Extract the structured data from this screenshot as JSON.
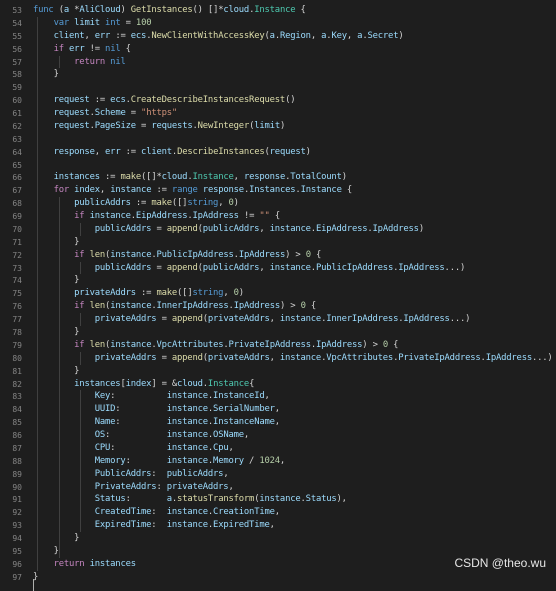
{
  "editor": {
    "lines": [
      {
        "n": "53",
        "text": "func (a *AliCloud) GetInstances() []*cloud.Instance {"
      },
      {
        "n": "54",
        "text": "    var limit int = 100"
      },
      {
        "n": "55",
        "text": "    client, err := ecs.NewClientWithAccessKey(a.Region, a.Key, a.Secret)"
      },
      {
        "n": "56",
        "text": "    if err != nil {"
      },
      {
        "n": "57",
        "text": "        return nil"
      },
      {
        "n": "58",
        "text": "    }"
      },
      {
        "n": "59",
        "text": ""
      },
      {
        "n": "60",
        "text": "    request := ecs.CreateDescribeInstancesRequest()"
      },
      {
        "n": "61",
        "text": "    request.Scheme = \"https\""
      },
      {
        "n": "62",
        "text": "    request.PageSize = requests.NewInteger(limit)"
      },
      {
        "n": "63",
        "text": ""
      },
      {
        "n": "64",
        "text": "    response, err := client.DescribeInstances(request)"
      },
      {
        "n": "65",
        "text": ""
      },
      {
        "n": "66",
        "text": "    instances := make([]*cloud.Instance, response.TotalCount)"
      },
      {
        "n": "67",
        "text": "    for index, instance := range response.Instances.Instance {"
      },
      {
        "n": "68",
        "text": "        publicAddrs := make([]string, 0)"
      },
      {
        "n": "69",
        "text": "        if instance.EipAddress.IpAddress != \"\" {"
      },
      {
        "n": "70",
        "text": "            publicAddrs = append(publicAddrs, instance.EipAddress.IpAddress)"
      },
      {
        "n": "71",
        "text": "        }"
      },
      {
        "n": "72",
        "text": "        if len(instance.PublicIpAddress.IpAddress) > 0 {"
      },
      {
        "n": "73",
        "text": "            publicAddrs = append(publicAddrs, instance.PublicIpAddress.IpAddress...)"
      },
      {
        "n": "74",
        "text": "        }"
      },
      {
        "n": "75",
        "text": "        privateAddrs := make([]string, 0)"
      },
      {
        "n": "76",
        "text": "        if len(instance.InnerIpAddress.IpAddress) > 0 {"
      },
      {
        "n": "77",
        "text": "            privateAddrs = append(privateAddrs, instance.InnerIpAddress.IpAddress...)"
      },
      {
        "n": "78",
        "text": "        }"
      },
      {
        "n": "79",
        "text": "        if len(instance.VpcAttributes.PrivateIpAddress.IpAddress) > 0 {"
      },
      {
        "n": "80",
        "text": "            privateAddrs = append(privateAddrs, instance.VpcAttributes.PrivateIpAddress.IpAddress...)"
      },
      {
        "n": "81",
        "text": "        }"
      },
      {
        "n": "82",
        "text": "        instances[index] = &cloud.Instance{"
      },
      {
        "n": "83",
        "text": "            Key:          instance.InstanceId,"
      },
      {
        "n": "84",
        "text": "            UUID:         instance.SerialNumber,"
      },
      {
        "n": "85",
        "text": "            Name:         instance.InstanceName,"
      },
      {
        "n": "86",
        "text": "            OS:           instance.OSName,"
      },
      {
        "n": "87",
        "text": "            CPU:          instance.Cpu,"
      },
      {
        "n": "88",
        "text": "            Memory:       instance.Memory / 1024,"
      },
      {
        "n": "89",
        "text": "            PublicAddrs:  publicAddrs,"
      },
      {
        "n": "90",
        "text": "            PrivateAddrs: privateAddrs,"
      },
      {
        "n": "91",
        "text": "            Status:       a.statusTransform(instance.Status),"
      },
      {
        "n": "92",
        "text": "            CreatedTime:  instance.CreationTime,"
      },
      {
        "n": "93",
        "text": "            ExpiredTime:  instance.ExpiredTime,"
      },
      {
        "n": "94",
        "text": "        }"
      },
      {
        "n": "95",
        "text": "    }"
      },
      {
        "n": "96",
        "text": "    return instances"
      },
      {
        "n": "97",
        "text": "}"
      }
    ]
  },
  "watermark": "CSDN @theo.wu",
  "colors": {
    "background": "#1e1e1e",
    "keyword": "#569cd6",
    "control": "#c586c0",
    "function": "#dcdcaa",
    "string": "#ce9178",
    "number": "#b5cea8",
    "variable": "#9cdcfe",
    "type": "#4ec9b0",
    "line_number": "#858585"
  }
}
